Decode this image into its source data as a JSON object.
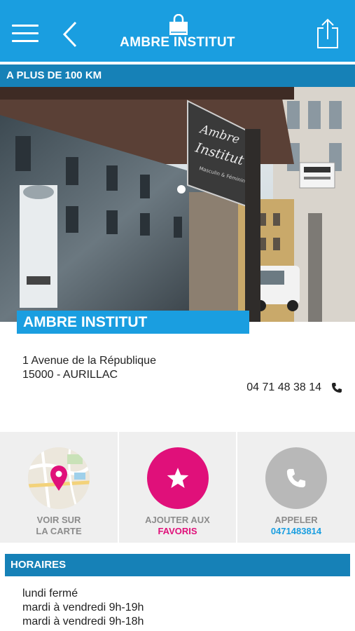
{
  "header": {
    "title": "AMBRE INSTITUT",
    "menu_icon": "hamburger-menu-icon",
    "back_icon": "chevron-left-icon",
    "bag_icon": "shopping-bag-icon",
    "share_icon": "share-icon",
    "color": "#1a9ee0"
  },
  "distance_label": "A PLUS DE 100 KM",
  "photo": {
    "sign_line1": "Ambre",
    "sign_line2": "Institut",
    "sign_line3": "Masculin & Féminin"
  },
  "shop": {
    "name": "AMBRE INSTITUT",
    "address_line1": "1 Avenue de la République",
    "address_line2": "15000 - AURILLAC",
    "phone": "04 71 48 38 14"
  },
  "actions": {
    "map": {
      "label1": "VOIR SUR",
      "label2": "LA CARTE",
      "icon": "map-pin-icon"
    },
    "favorite": {
      "label1": "AJOUTER AUX",
      "label2": "FAVORIS",
      "icon": "star-icon",
      "accent": "#e0107a"
    },
    "call": {
      "label1": "APPELER",
      "label2": "0471483814",
      "icon": "phone-icon",
      "accent": "#1a9ee0"
    }
  },
  "hours": {
    "title": "HORAIRES",
    "lines": [
      "lundi fermé",
      "mardi à vendredi 9h-19h",
      "mardi à vendredi 9h-18h"
    ]
  }
}
